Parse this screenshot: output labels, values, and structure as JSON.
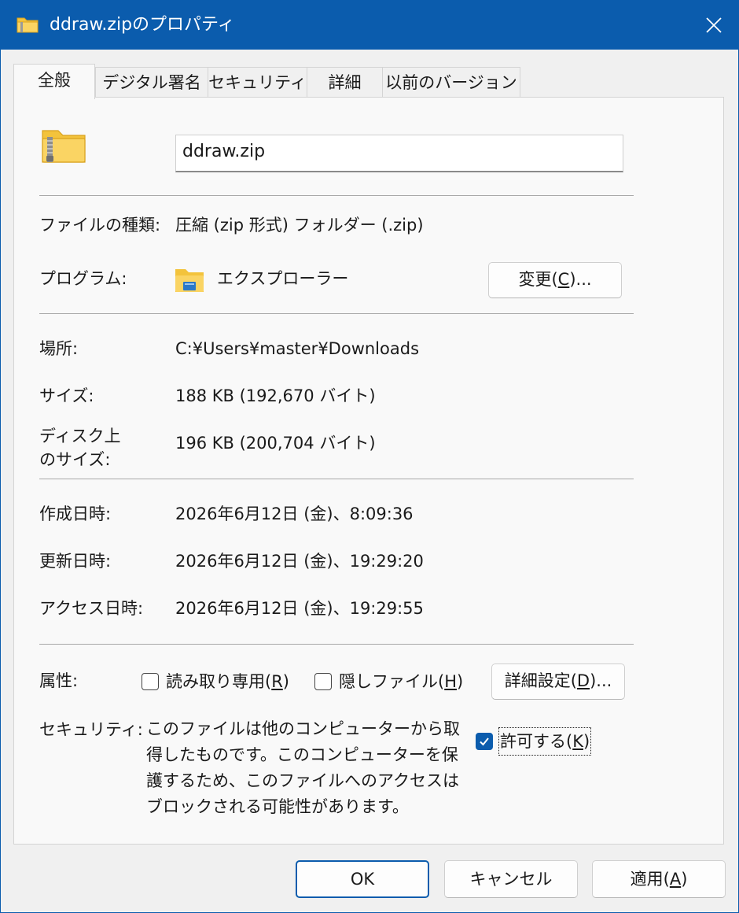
{
  "window": {
    "title": "ddraw.zipのプロパティ"
  },
  "tabs": [
    {
      "label": "全般"
    },
    {
      "label": "デジタル署名"
    },
    {
      "label": "セキュリティ"
    },
    {
      "label": "詳細"
    },
    {
      "label": "以前のバージョン"
    }
  ],
  "file": {
    "name": "ddraw.zip"
  },
  "props": {
    "type_label": "ファイルの種類:",
    "type_value": "圧縮 (zip 形式) フォルダー (.zip)",
    "program_label": "プログラム:",
    "program_value": "エクスプローラー",
    "change_btn_prefix": "変更(",
    "change_btn_key": "C",
    "change_btn_suffix": ")...",
    "location_label": "場所:",
    "location_value": "C:¥Users¥master¥Downloads",
    "size_label": "サイズ:",
    "size_value": "188 KB (192,670 バイト)",
    "disk_size_label_1": "ディスク上",
    "disk_size_label_2": "のサイズ:",
    "disk_size_value": "196 KB (200,704 バイト)",
    "created_label": "作成日時:",
    "created_value": "2026年6月12日 (金)、8:09:36",
    "modified_label": "更新日時:",
    "modified_value": "2026年6月12日 (金)、19:29:20",
    "accessed_label": "アクセス日時:",
    "accessed_value": "2026年6月12日 (金)、19:29:55"
  },
  "attributes": {
    "label": "属性:",
    "readonly_prefix": "読み取り専用(",
    "readonly_key": "R",
    "readonly_suffix": ")",
    "readonly_checked": false,
    "hidden_prefix": "隠しファイル(",
    "hidden_key": "H",
    "hidden_suffix": ")",
    "hidden_checked": false,
    "advanced_prefix": "詳細設定(",
    "advanced_key": "D",
    "advanced_suffix": ")..."
  },
  "security": {
    "label": "セキュリティ:",
    "text": "このファイルは他のコンピューターから取得したものです。このコンピューターを保護するため、このファイルへのアクセスはブロックされる可能性があります。",
    "unblock_prefix": "許可する(",
    "unblock_key": "K",
    "unblock_suffix": ")",
    "unblock_checked": true
  },
  "buttons": {
    "ok": "OK",
    "cancel": "キャンセル",
    "apply_prefix": "適用(",
    "apply_key": "A",
    "apply_suffix": ")"
  },
  "colors": {
    "accent": "#0b5cad",
    "folder_yellow": "#f3c33c"
  },
  "icons": {
    "title": "zip-folder-icon",
    "file": "zip-folder-icon",
    "program": "explorer-folder-icon",
    "close": "close-icon",
    "check": "checkmark-icon"
  }
}
